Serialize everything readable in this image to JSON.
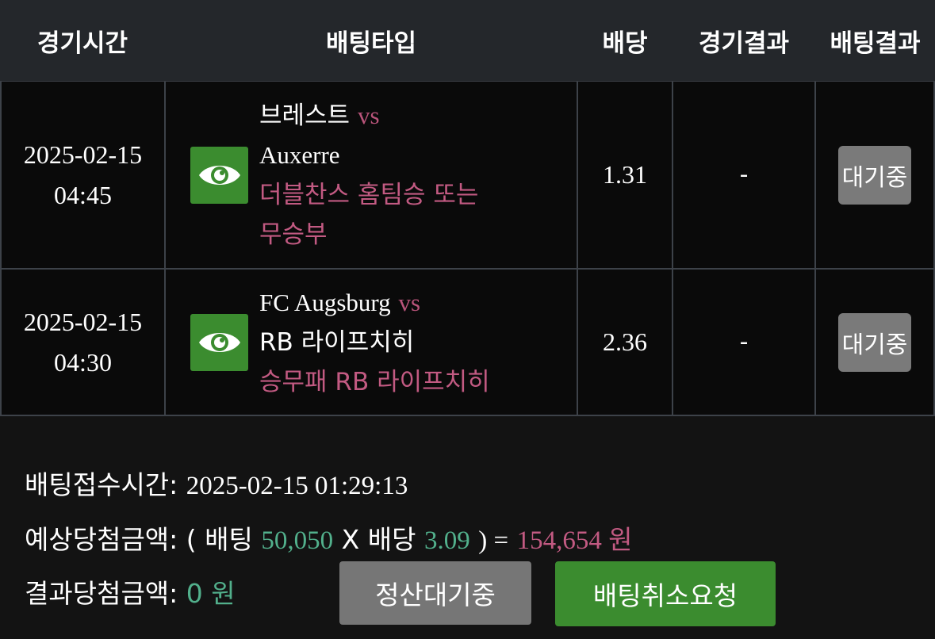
{
  "header": {
    "col_time": "경기시간",
    "col_bettype": "배팅타입",
    "col_odds": "배당",
    "col_game_result": "경기결과",
    "col_bet_result": "배팅결과"
  },
  "rows": [
    {
      "date": "2025-02-15",
      "time": "04:45",
      "home": "브레스트",
      "vs": "vs",
      "away": "Auxerre",
      "pick_line1": "더블찬스 홈팀승 또는",
      "pick_line2": "무승부",
      "odds": "1.31",
      "game_result": "-",
      "bet_result": "대기중"
    },
    {
      "date": "2025-02-15",
      "time": "04:30",
      "home": "FC Augsburg",
      "vs": "vs",
      "away": "RB 라이프치히",
      "pick_line1": "승무패 RB 라이프치히",
      "odds": "2.36",
      "game_result": "-",
      "bet_result": "대기중"
    }
  ],
  "summary": {
    "received_label": "배팅접수시간:",
    "received_value": "2025-02-15 01:29:13",
    "expected_label": "예상당첨금액:",
    "expected_open": "( 배팅",
    "expected_bet": "50,050",
    "expected_x": "X 배당",
    "expected_odds": "3.09",
    "expected_close": ") =",
    "expected_payout": "154,654 원",
    "result_label": "결과당첨금액:",
    "result_value": "0 원"
  },
  "buttons": {
    "settle_wait": "정산대기중",
    "cancel_request": "배팅취소요청"
  },
  "icons": {
    "view": "eye-icon"
  },
  "colors": {
    "header_bg": "#24272b",
    "accent_green": "#3b8c2f",
    "pick_pink": "#c25a82",
    "value_green": "#52b08c"
  }
}
